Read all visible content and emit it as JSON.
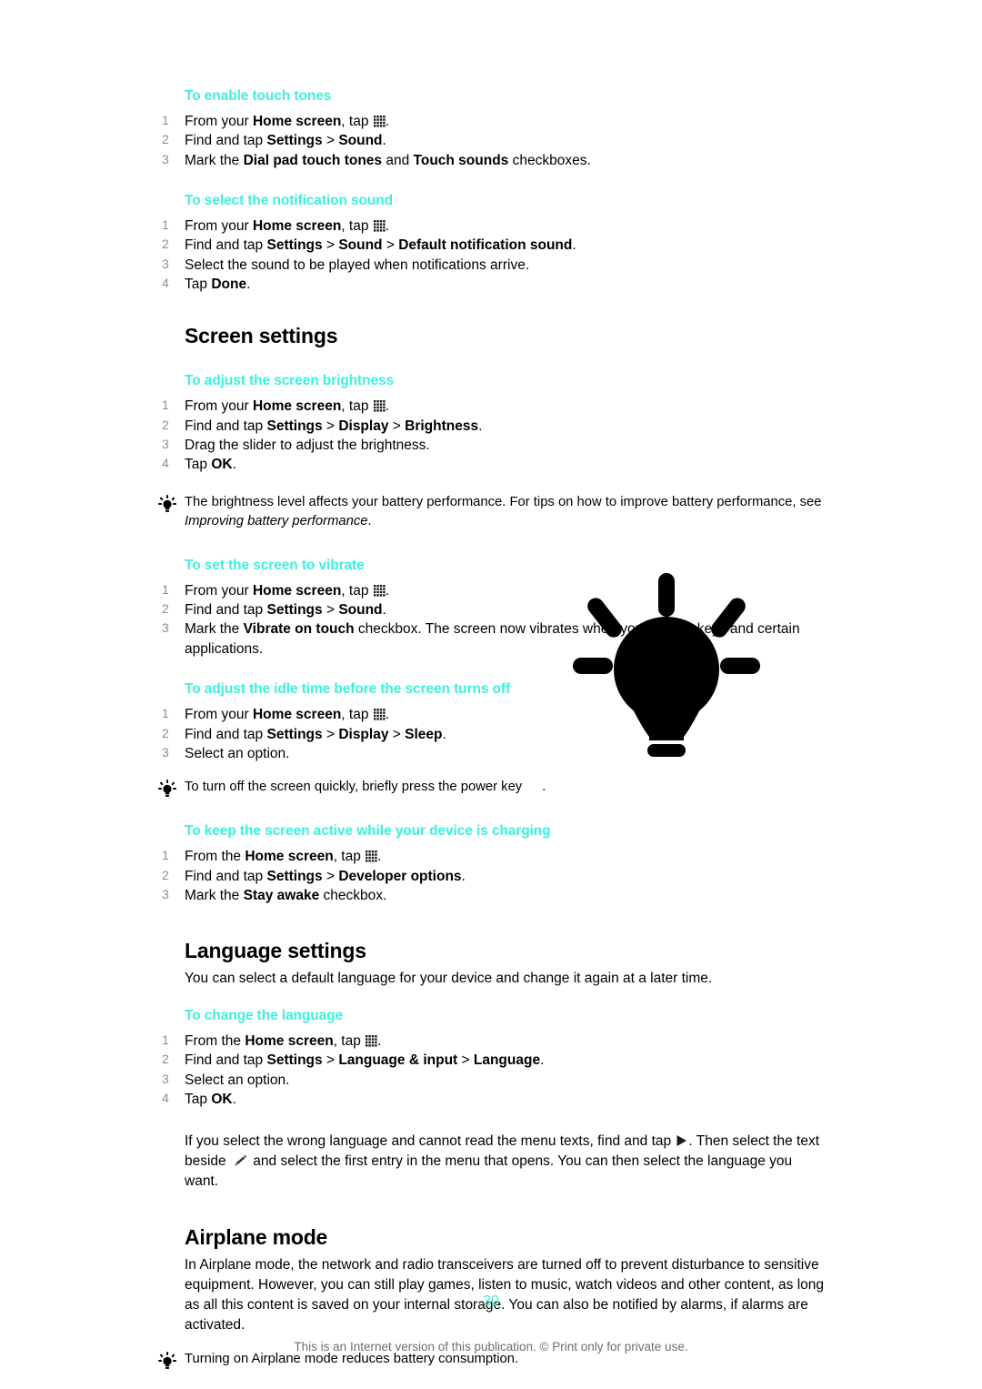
{
  "document": {
    "page_number": "30",
    "footer_note": "This is an Internet version of this publication. © Print only for private use.",
    "heading_color": "#3BF2DC",
    "step_number_color": "#8d8d8d"
  },
  "procedures": {
    "touch_tones": {
      "title": "To enable touch tones",
      "steps": [
        {
          "num": "1",
          "parts": [
            {
              "t": "From your "
            },
            {
              "t": "Home screen",
              "b": true
            },
            {
              "t": ", tap "
            },
            {
              "icon": "app-grid"
            },
            {
              "t": "."
            }
          ]
        },
        {
          "num": "2",
          "parts": [
            {
              "t": "Find and tap "
            },
            {
              "t": "Settings",
              "b": true
            },
            {
              "t": " > "
            },
            {
              "t": "Sound",
              "b": true
            },
            {
              "t": "."
            }
          ]
        },
        {
          "num": "3",
          "parts": [
            {
              "t": "Mark the "
            },
            {
              "t": "Dial pad touch tones",
              "b": true
            },
            {
              "t": " and "
            },
            {
              "t": "Touch sounds",
              "b": true
            },
            {
              "t": " checkboxes."
            }
          ]
        }
      ]
    },
    "notification_sound": {
      "title": "To select the notification sound",
      "steps": [
        {
          "num": "1",
          "parts": [
            {
              "t": "From your "
            },
            {
              "t": "Home screen",
              "b": true
            },
            {
              "t": ", tap "
            },
            {
              "icon": "app-grid"
            },
            {
              "t": "."
            }
          ]
        },
        {
          "num": "2",
          "parts": [
            {
              "t": "Find and tap "
            },
            {
              "t": "Settings",
              "b": true
            },
            {
              "t": " > "
            },
            {
              "t": "Sound",
              "b": true
            },
            {
              "t": " > "
            },
            {
              "t": "Default notification sound",
              "b": true
            },
            {
              "t": "."
            }
          ]
        },
        {
          "num": "3",
          "parts": [
            {
              "t": "Select the sound to be played when notifications arrive."
            }
          ]
        },
        {
          "num": "4",
          "parts": [
            {
              "t": "Tap "
            },
            {
              "t": "Done",
              "b": true
            },
            {
              "t": "."
            }
          ]
        }
      ]
    },
    "brightness": {
      "title": "To adjust the screen brightness",
      "steps": [
        {
          "num": "1",
          "parts": [
            {
              "t": "From your "
            },
            {
              "t": "Home screen",
              "b": true
            },
            {
              "t": ", tap "
            },
            {
              "icon": "app-grid"
            },
            {
              "t": "."
            }
          ]
        },
        {
          "num": "2",
          "parts": [
            {
              "t": "Find and tap "
            },
            {
              "t": "Settings",
              "b": true
            },
            {
              "t": " > "
            },
            {
              "t": "Display",
              "b": true
            },
            {
              "t": " > "
            },
            {
              "t": "Brightness",
              "b": true
            },
            {
              "t": "."
            }
          ]
        },
        {
          "num": "3",
          "parts": [
            {
              "t": "Drag the slider to adjust the brightness."
            }
          ]
        },
        {
          "num": "4",
          "parts": [
            {
              "t": "Tap "
            },
            {
              "t": "OK",
              "b": true
            },
            {
              "t": "."
            }
          ]
        }
      ]
    },
    "vibrate": {
      "title": "To set the screen to vibrate",
      "steps": [
        {
          "num": "1",
          "parts": [
            {
              "t": "From your "
            },
            {
              "t": "Home screen",
              "b": true
            },
            {
              "t": ", tap "
            },
            {
              "icon": "app-grid"
            },
            {
              "t": "."
            }
          ]
        },
        {
          "num": "2",
          "parts": [
            {
              "t": "Find and tap "
            },
            {
              "t": "Settings",
              "b": true
            },
            {
              "t": " > "
            },
            {
              "t": "Sound",
              "b": true
            },
            {
              "t": "."
            }
          ]
        },
        {
          "num": "3",
          "parts": [
            {
              "t": "Mark the "
            },
            {
              "t": "Vibrate on touch",
              "b": true
            },
            {
              "t": " checkbox. The screen now vibrates when you tap soft keys and certain applications."
            }
          ]
        }
      ]
    },
    "idle_time": {
      "title": "To adjust the idle time before the screen turns off",
      "steps": [
        {
          "num": "1",
          "parts": [
            {
              "t": "From your "
            },
            {
              "t": "Home screen",
              "b": true
            },
            {
              "t": ", tap "
            },
            {
              "icon": "app-grid"
            },
            {
              "t": "."
            }
          ]
        },
        {
          "num": "2",
          "parts": [
            {
              "t": "Find and tap "
            },
            {
              "t": "Settings",
              "b": true
            },
            {
              "t": " > "
            },
            {
              "t": "Display",
              "b": true
            },
            {
              "t": " > "
            },
            {
              "t": "Sleep",
              "b": true
            },
            {
              "t": "."
            }
          ]
        },
        {
          "num": "3",
          "parts": [
            {
              "t": "Select an option."
            }
          ]
        }
      ]
    },
    "stay_awake": {
      "title": "To keep the screen active while your device is charging",
      "steps": [
        {
          "num": "1",
          "parts": [
            {
              "t": "From the "
            },
            {
              "t": "Home screen",
              "b": true
            },
            {
              "t": ", tap "
            },
            {
              "icon": "app-grid"
            },
            {
              "t": "."
            }
          ]
        },
        {
          "num": "2",
          "parts": [
            {
              "t": "Find and tap "
            },
            {
              "t": "Settings",
              "b": true
            },
            {
              "t": " > "
            },
            {
              "t": "Developer options",
              "b": true
            },
            {
              "t": "."
            }
          ]
        },
        {
          "num": "3",
          "parts": [
            {
              "t": "Mark the "
            },
            {
              "t": "Stay awake",
              "b": true
            },
            {
              "t": " checkbox."
            }
          ]
        }
      ]
    },
    "change_language": {
      "title": "To change the language",
      "steps": [
        {
          "num": "1",
          "parts": [
            {
              "t": "From the "
            },
            {
              "t": "Home screen",
              "b": true
            },
            {
              "t": ", tap "
            },
            {
              "icon": "app-grid"
            },
            {
              "t": "."
            }
          ]
        },
        {
          "num": "2",
          "parts": [
            {
              "t": "Find and tap "
            },
            {
              "t": "Settings",
              "b": true
            },
            {
              "t": " > "
            },
            {
              "t": "Language & input",
              "b": true
            },
            {
              "t": " > "
            },
            {
              "t": "Language",
              "b": true
            },
            {
              "t": "."
            }
          ]
        },
        {
          "num": "3",
          "parts": [
            {
              "t": "Select an option."
            }
          ]
        },
        {
          "num": "4",
          "parts": [
            {
              "t": "Tap "
            },
            {
              "t": "OK",
              "b": true
            },
            {
              "t": "."
            }
          ]
        }
      ]
    }
  },
  "sections": {
    "screen_settings": {
      "title": "Screen settings"
    },
    "language_settings": {
      "title": "Language settings",
      "intro": "You can select a default language for your device and change it again at a later time.",
      "wrong_language_note": {
        "parts": [
          {
            "t": "If you select the wrong language and cannot read the menu texts, find and tap "
          },
          {
            "icon": "play-triangle"
          },
          {
            "t": ". Then select the text beside "
          },
          {
            "icon": "pencil"
          },
          {
            "t": " and select the first entry in the menu that opens. You can then select the language you want."
          }
        ]
      }
    },
    "airplane_mode": {
      "title": "Airplane mode",
      "body": "In Airplane mode, the network and radio transceivers are turned off to prevent disturbance to sensitive equipment. However, you can still play games, listen to music, watch videos and other content, as long as all this content is saved on your internal storage. You can also be notified by alarms, if alarms are activated."
    }
  },
  "tips": {
    "brightness_battery": {
      "parts": [
        {
          "t": "The brightness level affects your battery performance. For tips on how to improve battery performance, see "
        },
        {
          "t": "Improving battery performance",
          "i": true
        },
        {
          "t": "."
        }
      ]
    },
    "power_key": {
      "parts": [
        {
          "t": "To turn off the screen quickly, briefly press the power key"
        },
        {
          "icon": "missing-glyph"
        },
        {
          "t": "."
        }
      ]
    },
    "airplane_battery": {
      "parts": [
        {
          "t": "Turning on Airplane mode reduces battery consumption."
        }
      ]
    }
  }
}
